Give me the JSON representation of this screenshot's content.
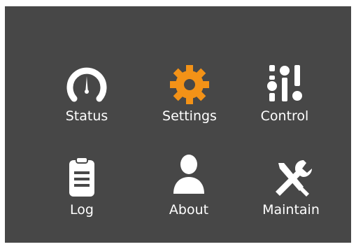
{
  "colors": {
    "background": "#474747",
    "icon": "#ffffff",
    "accent": "#f39217"
  },
  "menu": {
    "items": [
      {
        "label": "Status",
        "icon": "gauge-icon",
        "selected": false
      },
      {
        "label": "Settings",
        "icon": "gear-icon",
        "selected": true
      },
      {
        "label": "Control",
        "icon": "sliders-icon",
        "selected": false
      },
      {
        "label": "Log",
        "icon": "clipboard-icon",
        "selected": false
      },
      {
        "label": "About",
        "icon": "user-icon",
        "selected": false
      },
      {
        "label": "Maintain",
        "icon": "tools-icon",
        "selected": false
      }
    ]
  }
}
